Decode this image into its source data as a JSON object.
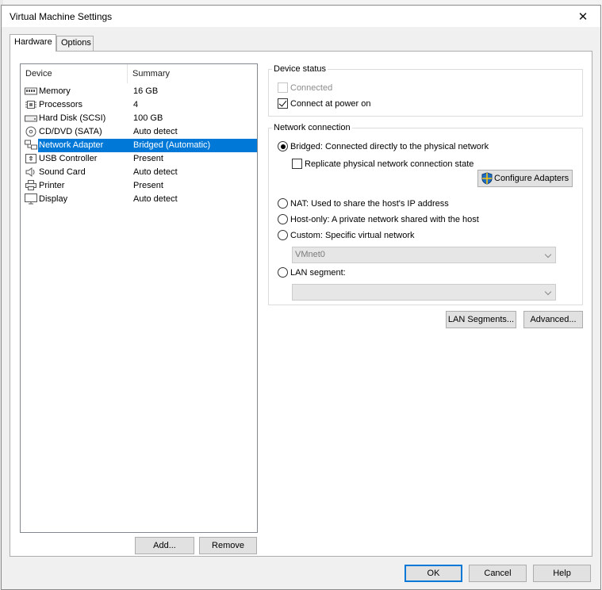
{
  "window": {
    "title": "Virtual Machine Settings"
  },
  "tabs": [
    {
      "label": "Hardware",
      "active": true
    },
    {
      "label": "Options",
      "active": false
    }
  ],
  "device_list": {
    "columns": [
      "Device",
      "Summary"
    ],
    "rows": [
      {
        "device": "Memory",
        "summary": "16 GB",
        "icon": "memory-icon"
      },
      {
        "device": "Processors",
        "summary": "4",
        "icon": "processor-icon"
      },
      {
        "device": "Hard Disk (SCSI)",
        "summary": "100 GB",
        "icon": "hard-disk-icon"
      },
      {
        "device": "CD/DVD (SATA)",
        "summary": "Auto detect",
        "icon": "cd-dvd-icon"
      },
      {
        "device": "Network Adapter",
        "summary": "Bridged (Automatic)",
        "icon": "network-adapter-icon",
        "selected": true
      },
      {
        "device": "USB Controller",
        "summary": "Present",
        "icon": "usb-icon"
      },
      {
        "device": "Sound Card",
        "summary": "Auto detect",
        "icon": "speaker-icon"
      },
      {
        "device": "Printer",
        "summary": "Present",
        "icon": "printer-icon"
      },
      {
        "device": "Display",
        "summary": "Auto detect",
        "icon": "display-icon"
      }
    ]
  },
  "list_buttons": {
    "add": "Add...",
    "remove": "Remove"
  },
  "device_status": {
    "title": "Device status",
    "connected": "Connected",
    "connect_at_power_on": "Connect at power on"
  },
  "network_connection": {
    "title": "Network connection",
    "bridged": "Bridged: Connected directly to the physical network",
    "replicate": "Replicate physical network connection state",
    "configure_adapters": "Configure Adapters",
    "nat": "NAT: Used to share the host's IP address",
    "host_only": "Host-only: A private network shared with the host",
    "custom": "Custom: Specific virtual network",
    "custom_value": "VMnet0",
    "lan_segment": "LAN segment:",
    "lan_segment_value": ""
  },
  "panel_buttons": {
    "lan_segments": "LAN Segments...",
    "advanced": "Advanced..."
  },
  "footer": {
    "ok": "OK",
    "cancel": "Cancel",
    "help": "Help"
  },
  "colors": {
    "selection": "#0078d7",
    "dialog_bg": "#f0f0f0"
  }
}
